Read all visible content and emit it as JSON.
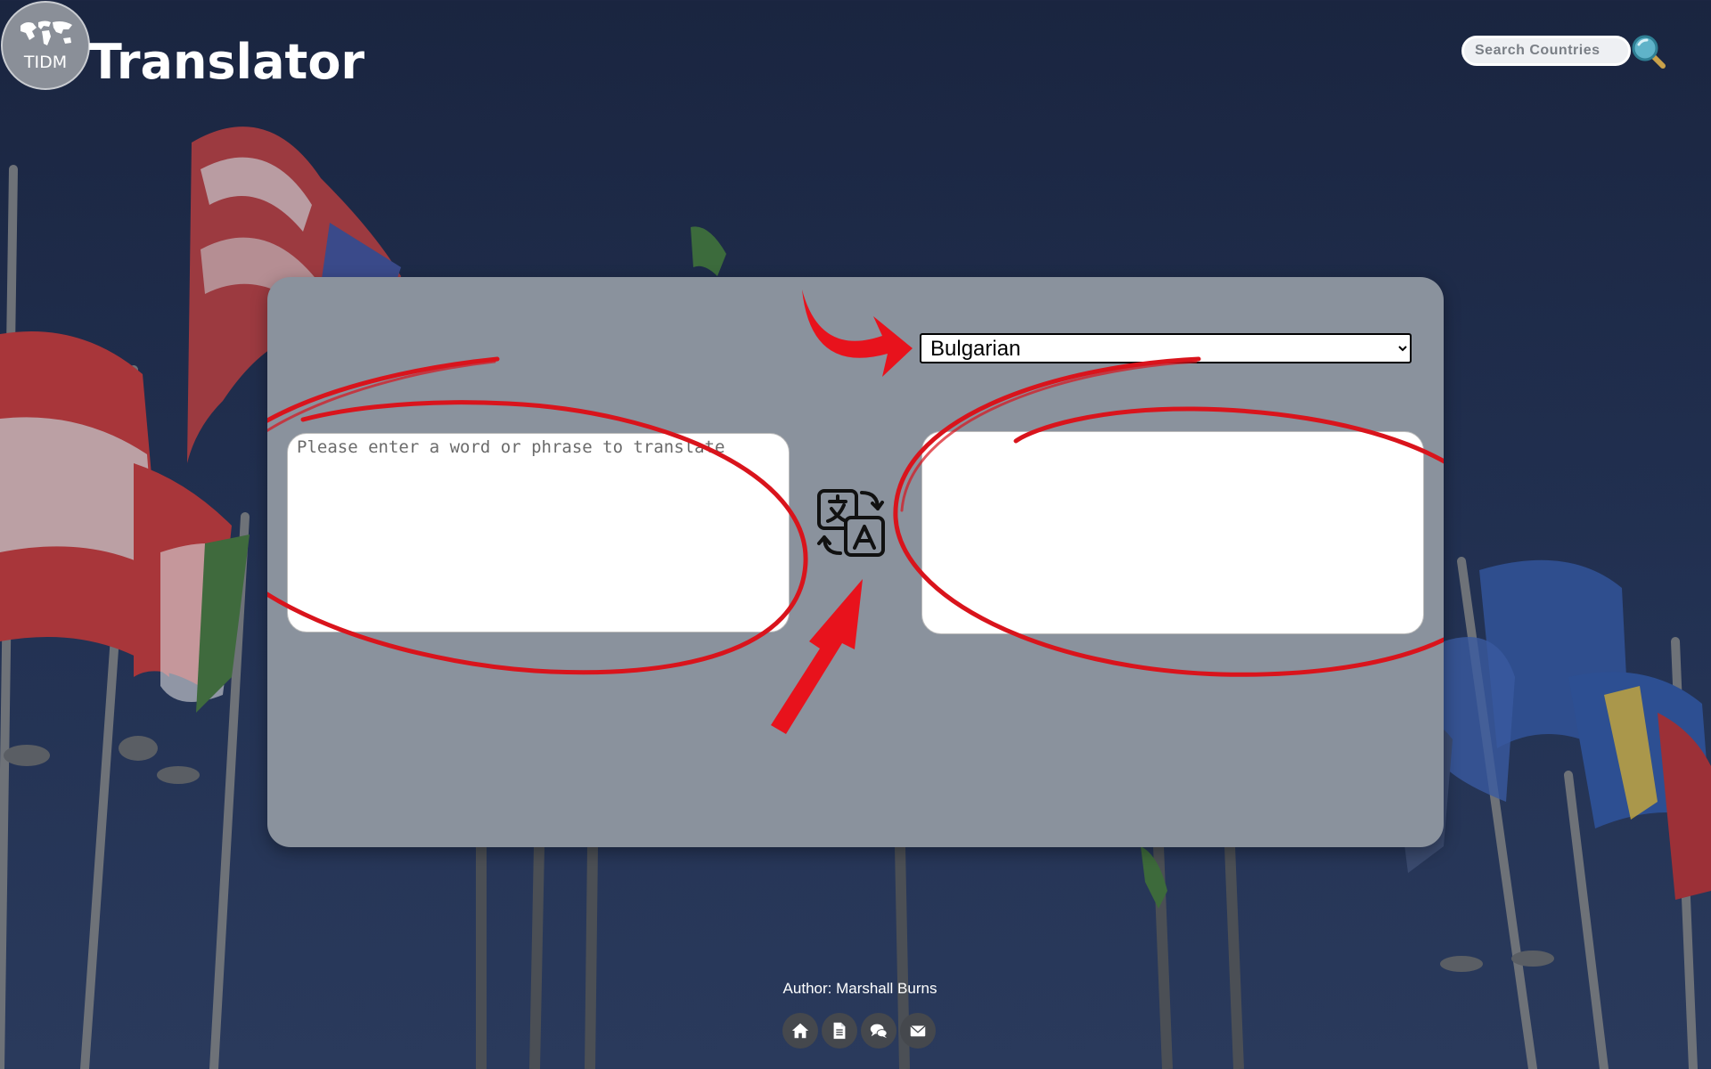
{
  "header": {
    "logo_text": "TIDM",
    "title": "Translator"
  },
  "search": {
    "placeholder": "Search Countries"
  },
  "translator": {
    "selected_language": "Bulgarian",
    "source_placeholder": "Please enter a word or phrase to translate",
    "target_text": ""
  },
  "footer": {
    "author": "Author: Marshall Burns"
  },
  "colors": {
    "card": "#8a929d",
    "annotation_red": "#d9141c",
    "background": "#1f2c4a"
  },
  "icons": {
    "search": "magnifier-icon",
    "translate": "translate-icon",
    "home": "home-icon",
    "document": "document-icon",
    "chat": "chat-icon",
    "mail": "mail-icon"
  }
}
